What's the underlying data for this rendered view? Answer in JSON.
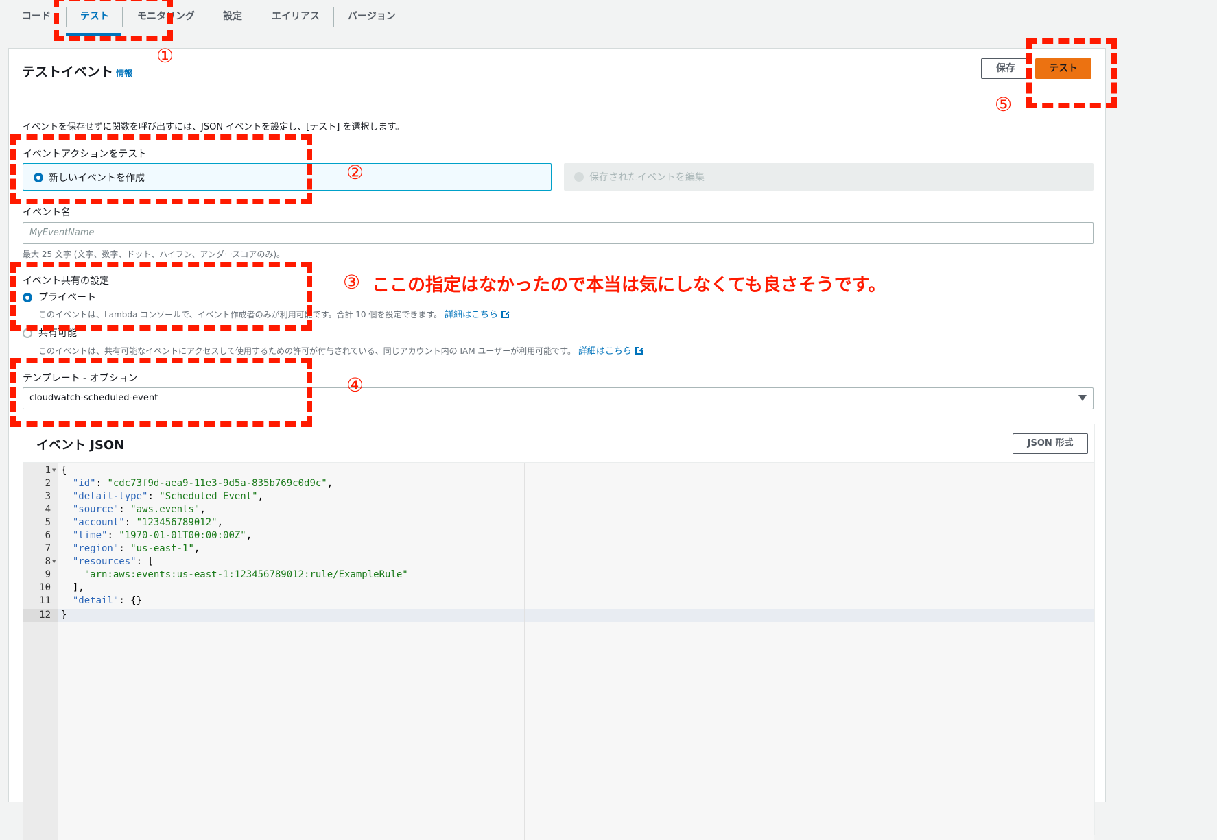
{
  "tabs": [
    {
      "label": "コード",
      "active": false
    },
    {
      "label": "テスト",
      "active": true
    },
    {
      "label": "モニタリング",
      "active": false
    },
    {
      "label": "設定",
      "active": false
    },
    {
      "label": "エイリアス",
      "active": false
    },
    {
      "label": "バージョン",
      "active": false
    }
  ],
  "header": {
    "title": "テストイベント",
    "info": "情報",
    "save_label": "保存",
    "test_label": "テスト"
  },
  "description": "イベントを保存せずに関数を呼び出すには、JSON イベントを設定し、[テスト] を選択します。",
  "event_action": {
    "label": "イベントアクションをテスト",
    "option_new": "新しいイベントを作成",
    "option_edit": "保存されたイベントを編集",
    "selected": "new"
  },
  "event_name": {
    "label": "イベント名",
    "placeholder": "MyEventName",
    "hint": "最大 25 文字 (文字、数字、ドット、ハイフン、アンダースコアのみ)。"
  },
  "sharing": {
    "label": "イベント共有の設定",
    "private_label": "プライベート",
    "private_desc": "このイベントは、Lambda コンソールで、イベント作成者のみが利用可能です。合計 10 個を設定できます。",
    "shared_label": "共有可能",
    "shared_desc": "このイベントは、共有可能なイベントにアクセスして使用するための許可が付与されている、同じアカウント内の IAM ユーザーが利用可能です。",
    "learn_more": "詳細はこちら",
    "selected": "private"
  },
  "template": {
    "label": "テンプレート - オプション",
    "value": "cloudwatch-scheduled-event"
  },
  "event_json": {
    "title": "イベント JSON",
    "format_button": "JSON 形式",
    "lines": [
      {
        "n": "1",
        "fold": true
      },
      {
        "n": "2",
        "fold": false
      },
      {
        "n": "3",
        "fold": false
      },
      {
        "n": "4",
        "fold": false
      },
      {
        "n": "5",
        "fold": false
      },
      {
        "n": "6",
        "fold": false
      },
      {
        "n": "7",
        "fold": false
      },
      {
        "n": "8",
        "fold": true
      },
      {
        "n": "9",
        "fold": false
      },
      {
        "n": "10",
        "fold": false
      },
      {
        "n": "11",
        "fold": false
      },
      {
        "n": "12",
        "fold": false
      }
    ],
    "code": {
      "l1": "{",
      "id_key": "\"id\"",
      "id_val": "\"cdc73f9d-aea9-11e3-9d5a-835b769c0d9c\"",
      "dt_key": "\"detail-type\"",
      "dt_val": "\"Scheduled Event\"",
      "src_key": "\"source\"",
      "src_val": "\"aws.events\"",
      "acc_key": "\"account\"",
      "acc_val": "\"123456789012\"",
      "time_key": "\"time\"",
      "time_val": "\"1970-01-01T00:00:00Z\"",
      "reg_key": "\"region\"",
      "reg_val": "\"us-east-1\"",
      "res_key": "\"resources\"",
      "res_item": "\"arn:aws:events:us-east-1:123456789012:rule/ExampleRule\"",
      "res_close": "],",
      "det_key": "\"detail\"",
      "det_val": "{}",
      "l12": "}"
    }
  },
  "annotations": {
    "n1": "①",
    "n2": "②",
    "n3": "③",
    "n4": "④",
    "n5": "⑤",
    "note3": "ここの指定はなかったので本当は気にしなくても良さそうです。",
    "color": "#ff1a00"
  }
}
